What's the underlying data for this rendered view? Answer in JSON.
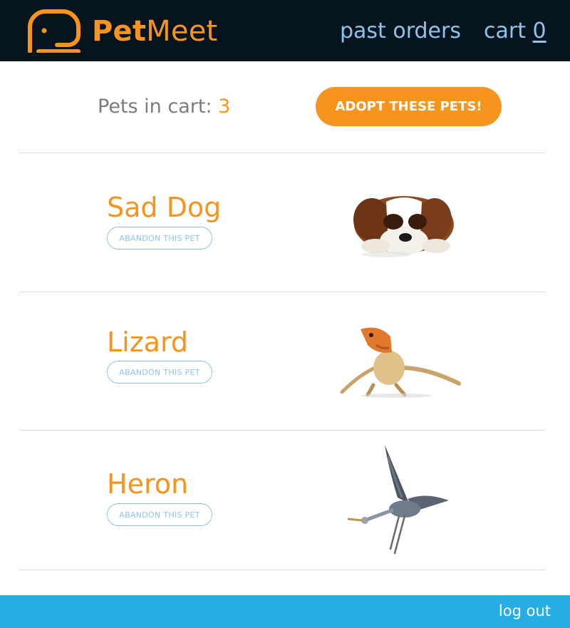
{
  "header": {
    "brand_part1": "Pet",
    "brand_part2": "Meet",
    "nav_orders": "past orders",
    "nav_cart": "cart",
    "cart_count": "0"
  },
  "summary": {
    "label": "Pets in cart:",
    "count": "3",
    "adopt_button": "ADOPT THESE PETS!"
  },
  "pets": [
    {
      "name": "Sad Dog",
      "abandon_label": "ABANDON THIS PET",
      "image": "dog-image"
    },
    {
      "name": "Lizard",
      "abandon_label": "ABANDON THIS PET",
      "image": "lizard-image"
    },
    {
      "name": "Heron",
      "abandon_label": "ABANDON THIS PET",
      "image": "heron-image"
    }
  ],
  "footer": {
    "logout": "log out"
  },
  "colors": {
    "header_bg": "#06141d",
    "brand_orange": "#f7941d",
    "link_blue": "#8ec4ec",
    "footer_bg": "#27ade4"
  }
}
